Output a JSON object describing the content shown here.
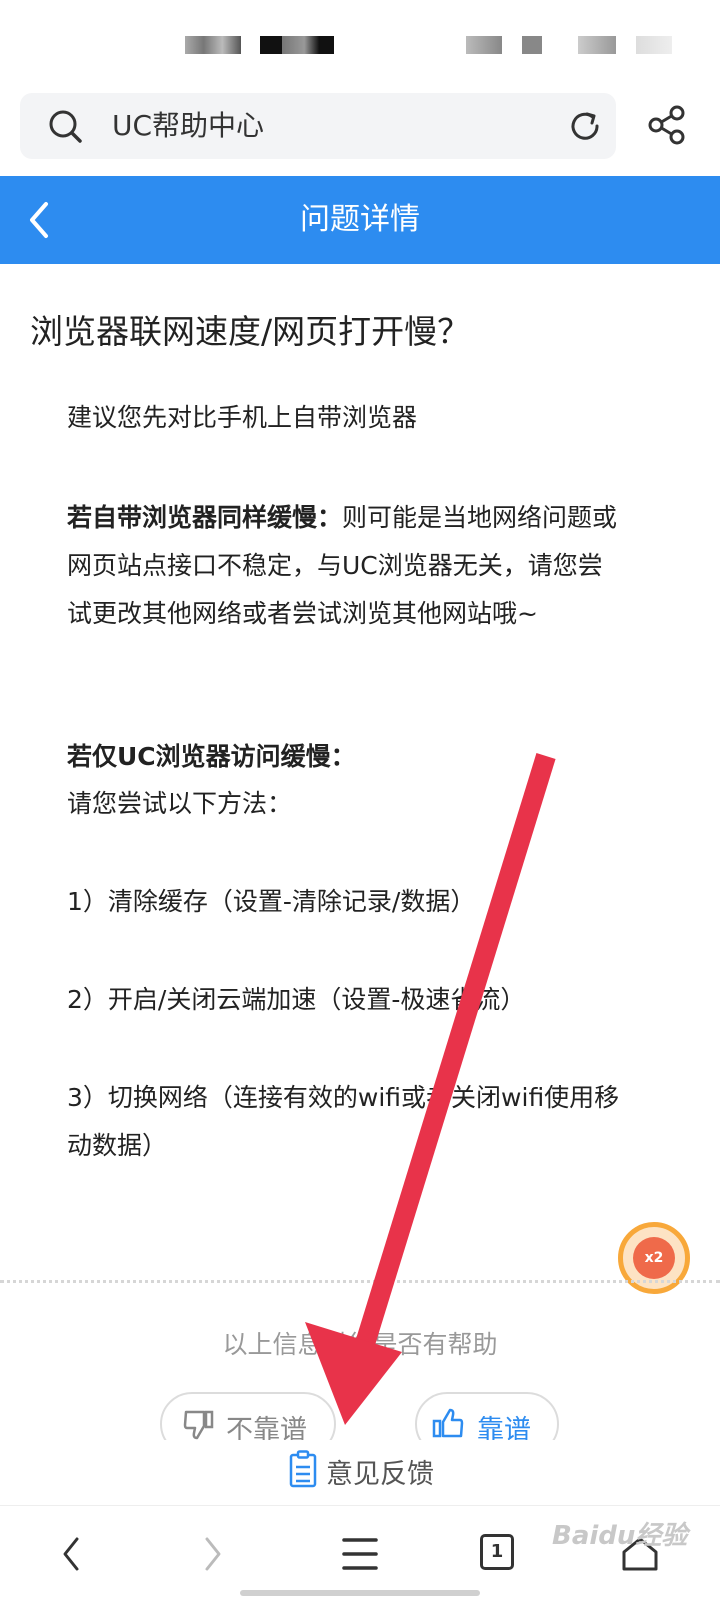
{
  "search": {
    "text": "UC帮助中心"
  },
  "header": {
    "title": "问题详情"
  },
  "article": {
    "title": "浏览器联网速度/网页打开慢？",
    "intro": "建议您先对比手机上自带浏览器",
    "case1_bold": "若自带浏览器同样缓慢：",
    "case1_text": "则可能是当地网络问题或网页站点接口不稳定，与UC浏览器无关，请您尝试更改其他网络或者尝试浏览其他网站哦~",
    "case2_bold": "若仅UC浏览器访问缓慢：",
    "case2_text": "请您尝试以下方法：",
    "step1": "1）清除缓存（设置-清除记录/数据）",
    "step2": "2）开启/关闭云端加速（设置-极速省流）",
    "step3": "3）切换网络（连接有效的wifi或者关闭wifi使用移动数据）"
  },
  "badge": {
    "label": "x2"
  },
  "feedback": {
    "question": "以上信息对您是否有帮助",
    "bad_label": "不靠谱",
    "good_label": "靠谱",
    "feedback_label": "意见反馈"
  },
  "watermark": "Baidu经验",
  "colors": {
    "primary": "#2d8cf0",
    "arrow": "#e8334a"
  },
  "icons": [
    "search-icon",
    "refresh-icon",
    "share-icon",
    "back-icon",
    "thumbs-down-icon",
    "thumbs-up-icon",
    "clipboard-icon",
    "nav-back-icon",
    "nav-forward-icon",
    "menu-icon",
    "tabs-icon",
    "home-icon"
  ],
  "nav": {
    "tab_count": "1"
  }
}
